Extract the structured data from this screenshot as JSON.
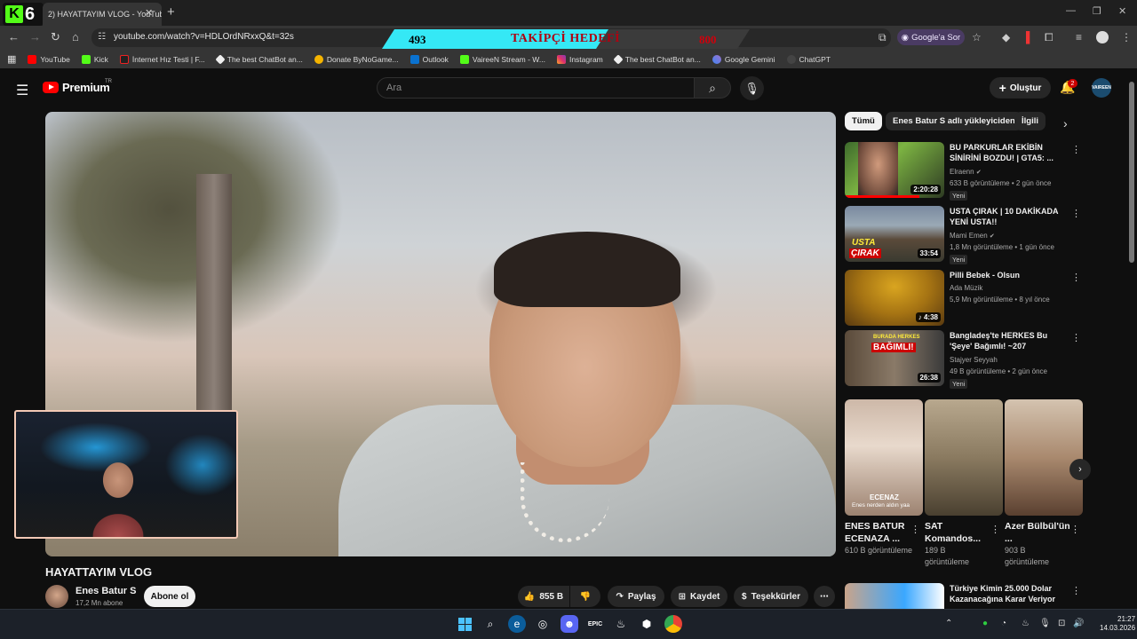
{
  "browser": {
    "kick_count": "6",
    "tab_title": "2) HAYATTAYIM VLOG - YouTube",
    "url": "youtube.com/watch?v=HDLOrdNRxxQ&t=32s",
    "google_button": "Google'a Sor",
    "bookmarks": [
      "YouTube",
      "Kick",
      "İnternet Hız Testi | F...",
      "The best ChatBot an...",
      "Donate ByNoGame...",
      "Outlook",
      "VaireeN Stream - W...",
      "Instagram",
      "The best ChatBot an...",
      "Google Gemini",
      "ChatGPT"
    ]
  },
  "overlay": {
    "current": "493",
    "title": "TAKİPÇİ HEDEFİ",
    "goal": "800",
    "progress": 0.616
  },
  "youtube": {
    "logo": "Premium",
    "logo_tr": "TR",
    "search_placeholder": "Ara",
    "create_label": "Oluştur",
    "notifications": "2",
    "avatar_text": "VAIREEN"
  },
  "video": {
    "title": "HAYATTAYIM VLOG",
    "channel": "Enes Batur S",
    "subscribers": "17,2 Mn abone",
    "subscribe_label": "Abone ol",
    "likes": "855 B",
    "share_label": "Paylaş",
    "save_label": "Kaydet",
    "thanks_label": "Teşekkürler"
  },
  "chips": [
    "Tümü",
    "Enes Batur S adlı yükleyiciden",
    "İlgili"
  ],
  "recommendations": [
    {
      "title": "BU PARKURLAR EKİBİN SİNİRİNİ BOZDU! | GTA5: ...",
      "channel": "Elraenn",
      "verified": true,
      "meta": "633 B görüntüleme • 2 gün önce",
      "badge": "Yeni",
      "duration": "2:20:28",
      "progress": 0.75
    },
    {
      "title": "USTA ÇIRAK | 10 DAKİKADA YENİ USTA!!",
      "channel": "Mami Emen",
      "verified": true,
      "meta": "1,8 Mn görüntüleme • 1 gün önce",
      "badge": "Yeni",
      "duration": "33:54",
      "progress": 0.0
    },
    {
      "title": "Pilli Bebek - Olsun",
      "channel": "Ada Müzik",
      "verified": false,
      "meta": "5,9 Mn görüntüleme • 8 yıl önce",
      "badge": "",
      "duration": "4:38",
      "progress": 0.0
    },
    {
      "title": "Bangladeş'te HERKES Bu 'Şeye' Bağımlı! ~207",
      "channel": "Stajyer Seyyah",
      "verified": false,
      "meta": "49 B görüntüleme • 2 gün önce",
      "badge": "Yeni",
      "duration": "26:38",
      "progress": 0.0
    },
    {
      "title": "Türkiye Kimin 25.000 Dolar Kazanacağına Karar Veriyor",
      "channel": "",
      "verified": false,
      "meta": "",
      "badge": "",
      "duration": "",
      "progress": 0.0
    }
  ],
  "thumb_texts": {
    "usta": "USTA",
    "cirak": "ÇIRAK",
    "buradaherkes": "BURADA HERKES",
    "bagimli": "BAĞIMLI!"
  },
  "shorts": [
    {
      "title": "ENES BATUR ECENAZA ...",
      "views": "610 B görüntüleme",
      "caption1": "ECENAZ",
      "caption2": "Enes nerden aldın yaa"
    },
    {
      "title": "SAT Komandos...",
      "views": "189 B görüntüleme",
      "caption1": "",
      "caption2": ""
    },
    {
      "title": "Azer Bülbül'ün ...",
      "views": "903 B görüntüleme",
      "caption1": "",
      "caption2": ""
    }
  ],
  "taskbar": {
    "time": "21:27",
    "date": "14.03.2026"
  },
  "colors": {
    "yt_red": "#ff0000",
    "kick_green": "#53fc18",
    "overlay_cyan": "#35e8f5",
    "overlay_red": "#b00010"
  }
}
